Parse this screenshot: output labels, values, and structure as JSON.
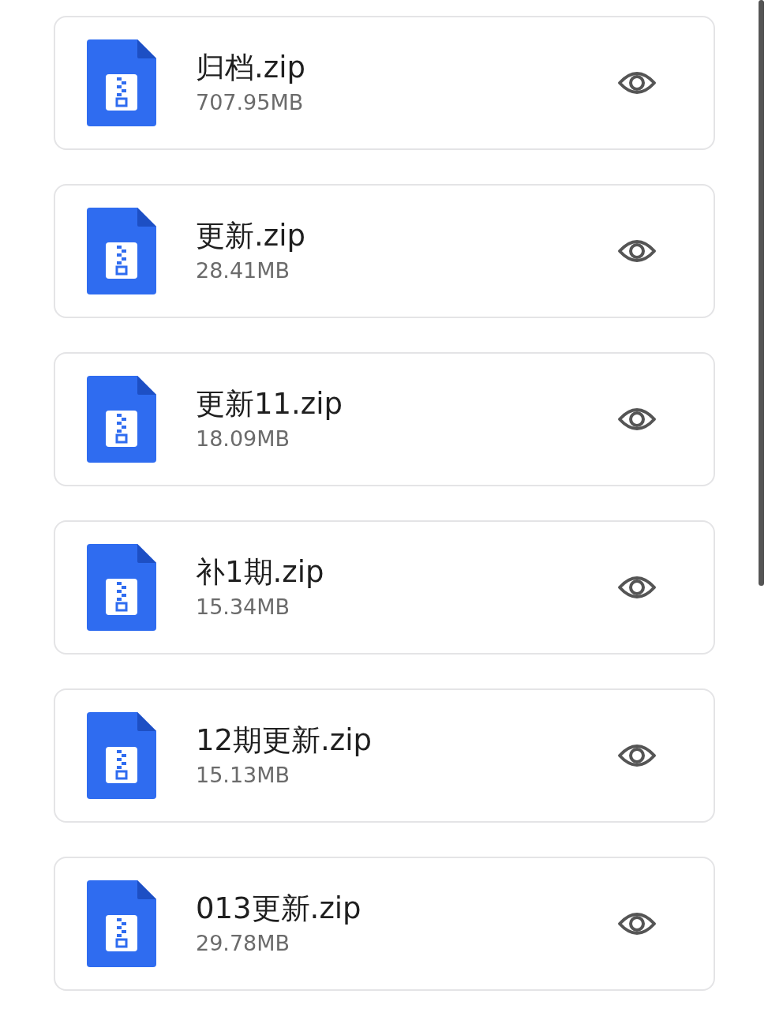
{
  "files": [
    {
      "name": "归档.zip",
      "size": "707.95MB"
    },
    {
      "name": "更新.zip",
      "size": "28.41MB"
    },
    {
      "name": "更新11.zip",
      "size": "18.09MB"
    },
    {
      "name": "补1期.zip",
      "size": "15.34MB"
    },
    {
      "name": "12期更新.zip",
      "size": "15.13MB"
    },
    {
      "name": "013更新.zip",
      "size": "29.78MB"
    }
  ]
}
